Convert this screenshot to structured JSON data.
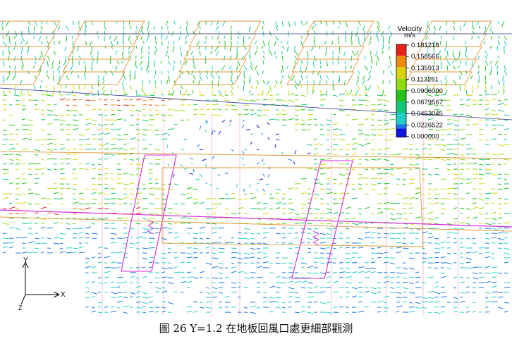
{
  "caption": "圖 26 Y=1.2 在地板回風口處更細部觀測",
  "legend": {
    "title": "Velocity",
    "unit": "m/s",
    "values": [
      "0.181218",
      "0.158566",
      "0.135913",
      "0.113261",
      "0.0906090",
      "0.0679567",
      "0.0453045",
      "0.0226522",
      "0.000000"
    ],
    "colors": [
      "#e8201a",
      "#f08a10",
      "#d9d40a",
      "#8fdc10",
      "#22c41a",
      "#12c878",
      "#1fd0c6",
      "#1a78e8",
      "#1212e0"
    ]
  },
  "axes": {
    "y_label": "Y",
    "x_label": "X",
    "z_label": "Z"
  },
  "palette": {
    "orange_outline": "#e09a3a",
    "magenta_outline": "#d62ad6",
    "pink_outline": "#e8a0c8",
    "blue_line": "#2a3a9a"
  }
}
